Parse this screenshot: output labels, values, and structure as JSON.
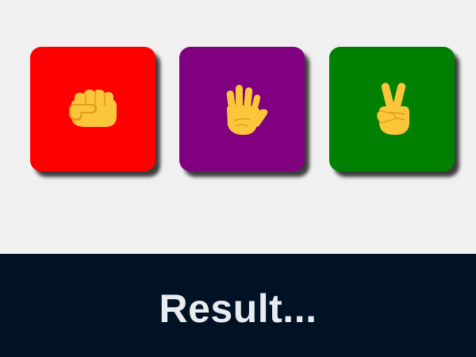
{
  "choices": [
    {
      "id": "rock",
      "icon": "fist-icon",
      "color": "#ff0000"
    },
    {
      "id": "paper",
      "icon": "raised-hand-icon",
      "color": "#800080"
    },
    {
      "id": "scissors",
      "icon": "victory-hand-icon",
      "color": "#008000"
    }
  ],
  "result": {
    "text": "Result..."
  },
  "colors": {
    "background": "#f0f0f0",
    "result_bar": "#021225",
    "result_text": "#e8ecf0",
    "hand_fill": "#fcc63b",
    "hand_shade": "#e59c1c"
  }
}
